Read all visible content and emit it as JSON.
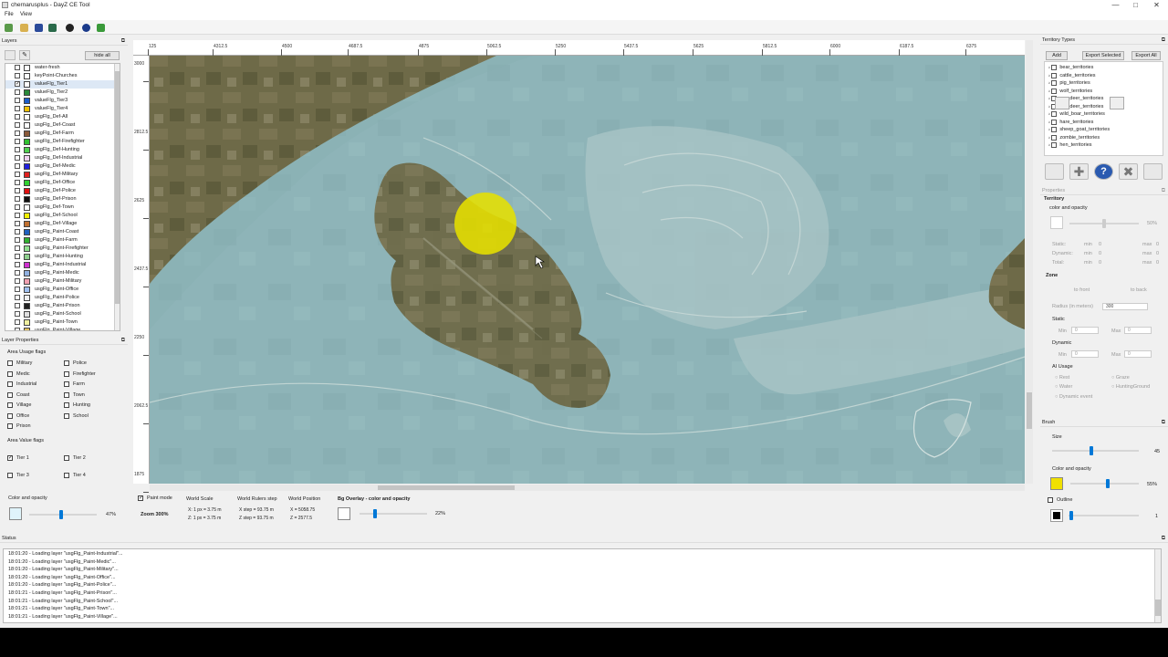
{
  "window": {
    "title": "chernarusplus - DayZ CE Tool",
    "minimize": "—",
    "maximize": "□",
    "close": "✕"
  },
  "menu": {
    "file": "File",
    "view": "View"
  },
  "layers_panel": {
    "title": "Layers",
    "hide_all": "hide all",
    "items": [
      {
        "name": "water-fresh",
        "checked": false,
        "color": "#ffffff"
      },
      {
        "name": "keyPoint-Churches",
        "checked": false,
        "color": "#ffffff"
      },
      {
        "name": "valueFlg_Tier1",
        "checked": true,
        "color": "#ffffff"
      },
      {
        "name": "valueFlg_Tier2",
        "checked": false,
        "color": "#2a8a3a"
      },
      {
        "name": "valueFlg_Tier3",
        "checked": false,
        "color": "#1c5cc8"
      },
      {
        "name": "valueFlg_Tier4",
        "checked": false,
        "color": "#f0c000"
      },
      {
        "name": "usgFlg_Def-All",
        "checked": false,
        "color": "#ffffff"
      },
      {
        "name": "usgFlg_Def-Coast",
        "checked": false,
        "color": "#ffffff"
      },
      {
        "name": "usgFlg_Def-Farm",
        "checked": false,
        "color": "#8a5a3a"
      },
      {
        "name": "usgFlg_Def-Firefighter",
        "checked": false,
        "color": "#30c030"
      },
      {
        "name": "usgFlg_Def-Hunting",
        "checked": false,
        "color": "#50d050"
      },
      {
        "name": "usgFlg_Def-Industrial",
        "checked": false,
        "color": "#f0d0f0"
      },
      {
        "name": "usgFlg_Def-Medic",
        "checked": false,
        "color": "#2020e0"
      },
      {
        "name": "usgFlg_Def-Military",
        "checked": false,
        "color": "#e02020"
      },
      {
        "name": "usgFlg_Def-Office",
        "checked": false,
        "color": "#30d030"
      },
      {
        "name": "usgFlg_Def-Police",
        "checked": false,
        "color": "#e01010"
      },
      {
        "name": "usgFlg_Def-Prison",
        "checked": false,
        "color": "#101010"
      },
      {
        "name": "usgFlg_Def-Town",
        "checked": false,
        "color": "#ffffff"
      },
      {
        "name": "usgFlg_Def-School",
        "checked": false,
        "color": "#f0f000"
      },
      {
        "name": "usgFlg_Def-Village",
        "checked": false,
        "color": "#c07030"
      },
      {
        "name": "usgFlg_Paint-Coast",
        "checked": false,
        "color": "#2060c0"
      },
      {
        "name": "usgFlg_Paint-Farm",
        "checked": false,
        "color": "#30b030"
      },
      {
        "name": "usgFlg_Paint-Firefighter",
        "checked": false,
        "color": "#90e090"
      },
      {
        "name": "usgFlg_Paint-Hunting",
        "checked": false,
        "color": "#8ed08e"
      },
      {
        "name": "usgFlg_Paint-Industrial",
        "checked": false,
        "color": "#d030d0"
      },
      {
        "name": "usgFlg_Paint-Medic",
        "checked": false,
        "color": "#90b0e0"
      },
      {
        "name": "usgFlg_Paint-Military",
        "checked": false,
        "color": "#f0a0b0"
      },
      {
        "name": "usgFlg_Paint-Office",
        "checked": false,
        "color": "#a0c0f0"
      },
      {
        "name": "usgFlg_Paint-Police",
        "checked": false,
        "color": "#f0f0f0"
      },
      {
        "name": "usgFlg_Paint-Prison",
        "checked": false,
        "color": "#202020"
      },
      {
        "name": "usgFlg_Paint-School",
        "checked": false,
        "color": "#e0e0e0"
      },
      {
        "name": "usgFlg_Paint-Town",
        "checked": false,
        "color": "#f0f0a0"
      },
      {
        "name": "usgFlg_Paint-Village",
        "checked": false,
        "color": "#e0c060"
      }
    ]
  },
  "layer_properties": {
    "title": "Layer Properties",
    "usage_title": "Area Usage flags",
    "usage": [
      {
        "label": "Military",
        "checked": false
      },
      {
        "label": "Police",
        "checked": false
      },
      {
        "label": "Medic",
        "checked": false
      },
      {
        "label": "Firefighter",
        "checked": false
      },
      {
        "label": "Industrial",
        "checked": false
      },
      {
        "label": "Farm",
        "checked": false
      },
      {
        "label": "Coast",
        "checked": false
      },
      {
        "label": "Town",
        "checked": false
      },
      {
        "label": "Village",
        "checked": false
      },
      {
        "label": "Hunting",
        "checked": false
      },
      {
        "label": "Office",
        "checked": false
      },
      {
        "label": "School",
        "checked": false
      },
      {
        "label": "Prison",
        "checked": false
      }
    ],
    "value_title": "Area Value flags",
    "values": [
      {
        "label": "Tier 1",
        "checked": true
      },
      {
        "label": "Tier 2",
        "checked": false
      },
      {
        "label": "Tier 3",
        "checked": false
      },
      {
        "label": "Tier 4",
        "checked": false
      }
    ],
    "color_opacity_label": "Color and opacity",
    "opacity": "47%",
    "opacity_fraction": 0.47,
    "swatch_color": "#e0f4fb"
  },
  "rulers": {
    "h": [
      "125",
      "4312.5",
      "4500",
      "4687.5",
      "4875",
      "5062.5",
      "5250",
      "5437.5",
      "5625",
      "5812.5",
      "6000",
      "6187.5",
      "6375"
    ],
    "v": [
      "3000",
      "2812.5",
      "2625",
      "2437.5",
      "2250",
      "2062.5",
      "1875"
    ]
  },
  "info": {
    "paint_mode": "Paint mode",
    "zoom": "Zoom  300%",
    "world_scale_title": "World Scale",
    "scale_x": "X: 1 px = 3.75 m",
    "scale_z": "Z: 1 px = 3.75 m",
    "rulers_step_title": "World Rulers step",
    "step_x": "X step = 93.75 m",
    "step_z": "Z step = 93.75 m",
    "position_title": "World Position",
    "pos_x": "X = 5058.75",
    "pos_z": "Z = 2577.5",
    "bg_overlay_title": "Bg Overlay - color and opacity",
    "bg_overlay_value": "22%",
    "bg_overlay_fraction": 0.22
  },
  "status": {
    "title": "Status",
    "lines": [
      "18:01:20 - Loading layer \"usgFlg_Paint-Industrial\"...",
      "18:01:20 - Loading layer \"usgFlg_Paint-Medic\"...",
      "18:01:20 - Loading layer \"usgFlg_Paint-Military\"...",
      "18:01:20 - Loading layer \"usgFlg_Paint-Office\"...",
      "18:01:20 - Loading layer \"usgFlg_Paint-Police\"...",
      "18:01:21 - Loading layer \"usgFlg_Paint-Prison\"...",
      "18:01:21 - Loading layer \"usgFlg_Paint-School\"...",
      "18:01:21 - Loading layer \"usgFlg_Paint-Town\"...",
      "18:01:21 - Loading layer \"usgFlg_Paint-Village\"..."
    ]
  },
  "territory": {
    "title": "Territory Types",
    "add": "Add",
    "export_selected": "Export Selected",
    "export_all": "Export All",
    "items": [
      "bear_territories",
      "cattle_territories",
      "pig_territories",
      "wolf_territories",
      "roe_deer_territories",
      "red_deer_territories",
      "wild_boar_territories",
      "hare_territories",
      "sheep_goat_territories",
      "zombie_territories",
      "hen_territories"
    ]
  },
  "properties": {
    "title": "Properties",
    "territory_title": "Territory",
    "color_opacity": "color and opacity",
    "opacity": "50%",
    "opacity_fraction": 0.5,
    "static": "Static:",
    "dynamic": "Dynamic:",
    "total": "Total:",
    "min": "min",
    "max": "max",
    "zero": "0",
    "zone_title": "Zone",
    "to_front": "to front",
    "to_back": "to back",
    "radius_label": "Radius (in meters)",
    "radius": "300",
    "static_title": "Static",
    "dynamic_title": "Dynamic",
    "min_label": "Min",
    "max_label": "Max",
    "ai_title": "AI Usage",
    "ai": [
      "Rest",
      "Graze",
      "Water",
      "HuntingGround",
      "Dynamic event"
    ]
  },
  "brush": {
    "title": "Brush",
    "size_label": "Size",
    "size": "45",
    "size_fraction": 0.45,
    "color_label": "Color and opacity",
    "opacity": "55%",
    "opacity_fraction": 0.55,
    "color": "#f0e000",
    "outline_label": "Outline",
    "outline_value": "1",
    "outline_color": "#000000"
  }
}
